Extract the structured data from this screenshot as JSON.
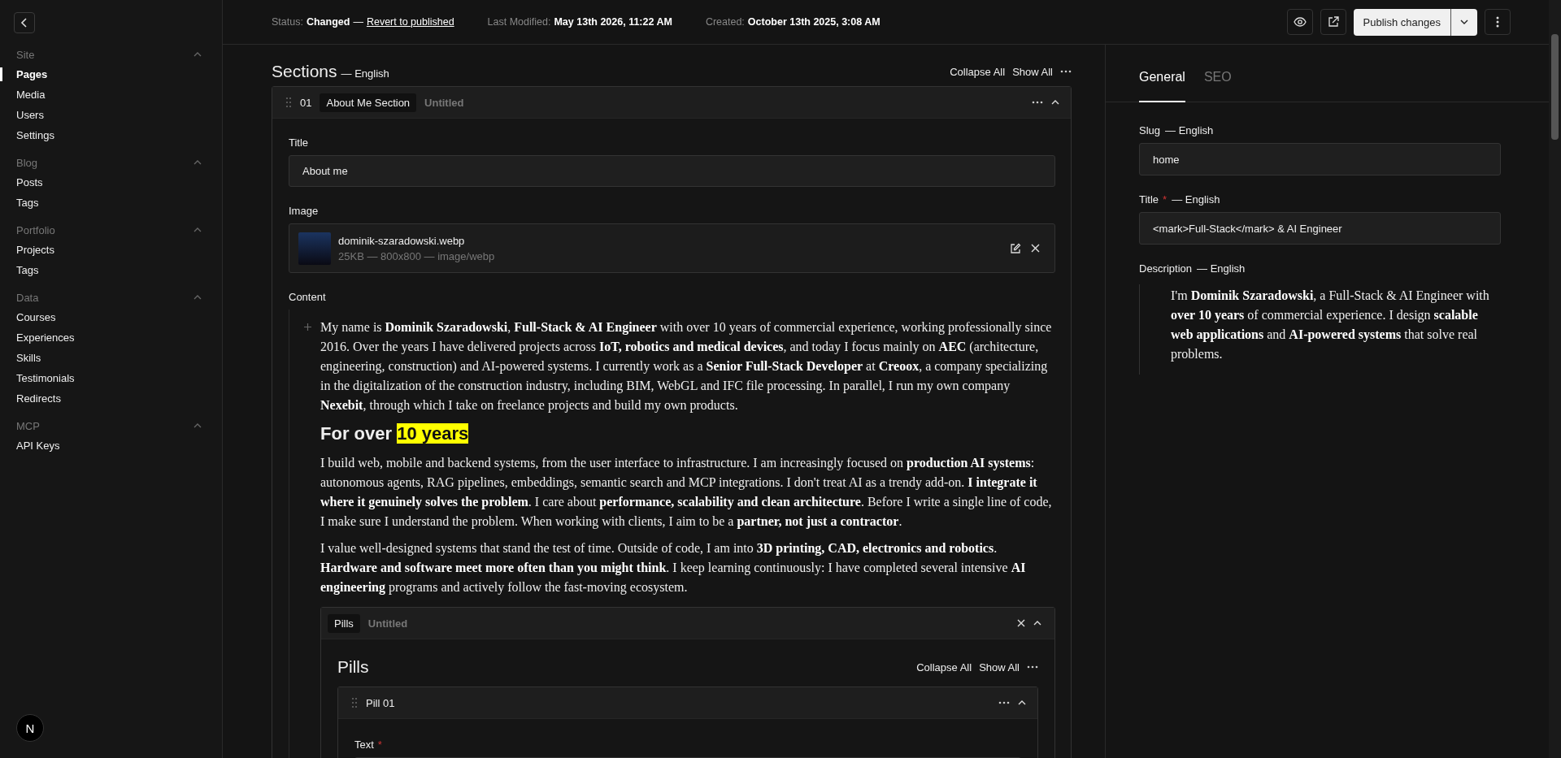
{
  "sidebar": {
    "groups": [
      {
        "label": "Site",
        "expanded": true,
        "items": [
          {
            "label": "Pages",
            "selected": true
          },
          {
            "label": "Media",
            "selected": false
          },
          {
            "label": "Users",
            "selected": false
          },
          {
            "label": "Settings",
            "selected": false
          }
        ]
      },
      {
        "label": "Blog",
        "expanded": true,
        "items": [
          {
            "label": "Posts",
            "selected": false
          },
          {
            "label": "Tags",
            "selected": false
          }
        ]
      },
      {
        "label": "Portfolio",
        "expanded": true,
        "items": [
          {
            "label": "Projects",
            "selected": false
          },
          {
            "label": "Tags",
            "selected": false
          }
        ]
      },
      {
        "label": "Data",
        "expanded": true,
        "items": [
          {
            "label": "Courses",
            "selected": false
          },
          {
            "label": "Experiences",
            "selected": false
          },
          {
            "label": "Skills",
            "selected": false
          },
          {
            "label": "Testimonials",
            "selected": false
          },
          {
            "label": "Redirects",
            "selected": false
          }
        ]
      },
      {
        "label": "MCP",
        "expanded": true,
        "items": [
          {
            "label": "API Keys",
            "selected": false
          }
        ]
      }
    ],
    "badge": "N"
  },
  "header": {
    "status_label": "Status:",
    "status_value": "Changed",
    "status_sep": "—",
    "revert_link": "Revert to published",
    "modified_label": "Last Modified:",
    "modified_value": "May 13th 2026, 11:22 AM",
    "created_label": "Created:",
    "created_value": "October 13th 2025, 3:08 AM",
    "publish_button": "Publish changes"
  },
  "sections": {
    "title": "Sections",
    "locale": "— English",
    "collapse_all": "Collapse All",
    "show_all": "Show All",
    "block": {
      "number": "01",
      "type": "About Me Section",
      "label": "Untitled",
      "expanded": true,
      "title_label": "Title",
      "title_value": "About me",
      "image_label": "Image",
      "image_name": "dominik-szaradowski.webp",
      "image_meta": "25KB — 800x800 — image/webp",
      "content_label": "Content",
      "content": [
        {
          "kind": "paragraph",
          "text": "My name is **Dominik Szaradowski**, **Full-Stack & AI Engineer** with over 10 years of commercial experience, working professionally since 2016. Over the years I have delivered projects across **IoT, robotics and medical devices**, and today I focus mainly on **AEC** (architecture, engineering, construction) and AI-powered systems. I currently work as a **Senior Full-Stack Developer** at **Creoox**, a company specializing in the digitalization of the construction industry, including BIM, WebGL and IFC file processing. In parallel, I run my own company **Nexebit**, through which I take on freelance projects and build my own products."
        },
        {
          "kind": "heading",
          "text": "For over",
          "marked": "10 years"
        },
        {
          "kind": "paragraph",
          "text": "I build web, mobile and backend systems, from the user interface to infrastructure. I am increasingly focused on **production AI systems**: autonomous agents, RAG pipelines, embeddings, semantic search and MCP integrations. I don't treat AI as a trendy add-on. **I integrate it where it genuinely solves the problem**. I care about **performance, scalability and clean architecture**. Before I write a single line of code, I make sure I understand the problem. When working with clients, I aim to be a **partner, not just a contractor**."
        },
        {
          "kind": "paragraph",
          "text": "I value well-designed systems that stand the test of time. Outside of code, I am into **3D printing, CAD, electronics and robotics**. **Hardware and software meet more often than you might think**. I keep learning continuously: I have completed several intensive **AI engineering** programs and actively follow the fast-moving ecosystem."
        }
      ],
      "nested": {
        "type": "Pills",
        "label": "Untitled",
        "expanded": true,
        "title": "Pills",
        "collapse_all": "Collapse All",
        "show_all": "Show All",
        "item": {
          "label": "Pill 01",
          "expanded": true,
          "field_label": "Text",
          "required_mark": "*"
        }
      }
    }
  },
  "panel": {
    "tabs": [
      {
        "label": "General",
        "selected": true
      },
      {
        "label": "SEO",
        "selected": false
      }
    ],
    "slug_label": "Slug",
    "slug_locale": "— English",
    "slug_value": "home",
    "title_label": "Title",
    "title_required_mark": "*",
    "title_locale": "— English",
    "title_value": "<mark>Full-Stack</mark> & AI Engineer",
    "description_label": "Description",
    "description_locale": "— English",
    "description": "I'm **Dominik Szaradowski**, a Full-Stack & AI Engineer with **over 10 years** of commercial experience. I design **scalable web applications** and **AI-powered systems** that solve real problems."
  }
}
